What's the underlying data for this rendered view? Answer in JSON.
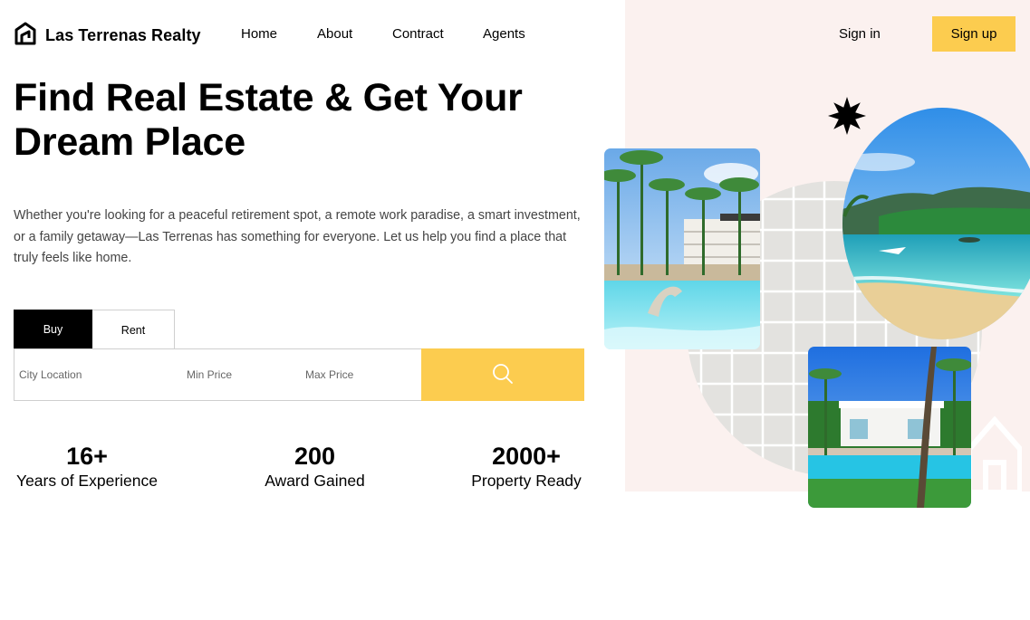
{
  "brand": {
    "name": "Las Terrenas Realty",
    "logo_icon": "house-logo-icon"
  },
  "nav": {
    "items": [
      "Home",
      "About",
      "Contract",
      "Agents"
    ]
  },
  "auth": {
    "signin_label": "Sign in",
    "signup_label": "Sign up"
  },
  "hero": {
    "title_line1": "Find Real Estate & Get Your",
    "title_line2": "Dream Place",
    "description": "Whether you're looking for a peaceful retirement spot, a remote work paradise, a smart investment, or a family getaway—Las Terrenas has something for everyone. Let us help you find a place that truly feels like home."
  },
  "search": {
    "tabs": [
      {
        "label": "Buy",
        "active": true
      },
      {
        "label": "Rent",
        "active": false
      }
    ],
    "city_placeholder": "City Location",
    "min_price_placeholder": "Min Price",
    "max_price_placeholder": "Max Price",
    "button_icon": "search-icon"
  },
  "stats": [
    {
      "value": "16+",
      "label": "Years of Experience"
    },
    {
      "value": "200",
      "label": "Award Gained"
    },
    {
      "value": "2000+",
      "label": "Property Ready"
    }
  ],
  "colors": {
    "accent": "#fccc4f",
    "panel_bg": "#fbf1ef",
    "dark": "#000000"
  }
}
